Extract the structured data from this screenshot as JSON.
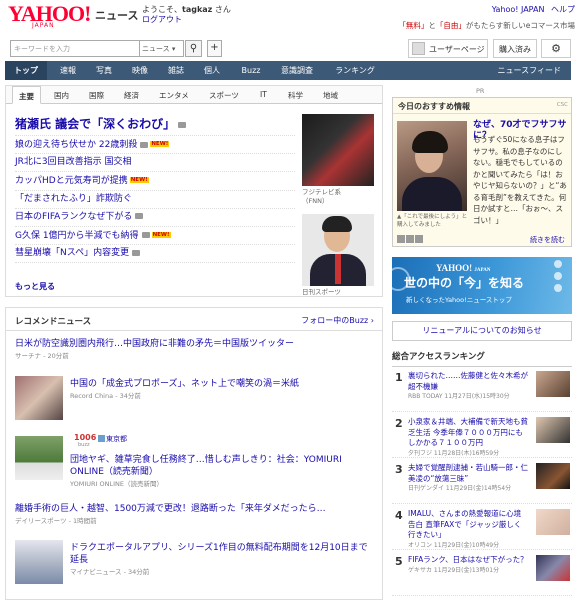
{
  "header": {
    "logo": "YAHOO!",
    "logo_sub": "JAPAN",
    "section": "ニュース",
    "welcome_prefix": "ようこそ、",
    "username": "tagkaz",
    "welcome_suffix": " さん",
    "logout": "ログアウト",
    "yahoo_japan_link": "Yahoo! JAPAN",
    "help_link": "ヘルプ",
    "promo_a": "「無料」",
    "promo_mid": "と",
    "promo_b": "「自由」",
    "promo_rest": "がもたらす新しいeコマース市場"
  },
  "search": {
    "placeholder": "キーワードを入力",
    "scope": "ニュース ▾",
    "user_page": "ユーザーページ",
    "purchased": "購入済み"
  },
  "nav": {
    "items": [
      "トップ",
      "速報",
      "写真",
      "映像",
      "雑誌",
      "個人",
      "Buzz",
      "意識調査",
      "ランキング"
    ],
    "feed": "ニュースフィード"
  },
  "subtabs": [
    "主要",
    "国内",
    "国際",
    "経済",
    "エンタメ",
    "スポーツ",
    "IT",
    "科学",
    "地域"
  ],
  "headlines": [
    {
      "text": "猪瀬氏 議会で「深くおわび」",
      "photo": true,
      "new": false
    },
    {
      "text": "娘の迎え待ち伏せか 22歳刺殺",
      "photo": true,
      "new": true
    },
    {
      "text": "JR北に3回目改善指示 国交相",
      "photo": false,
      "new": false
    },
    {
      "text": "カッパHDと元気寿司が提携",
      "photo": false,
      "new": true
    },
    {
      "text": "「だまされたふり」詐欺防ぐ",
      "photo": false,
      "new": false
    },
    {
      "text": "日本のFIFAランクなぜ下がる",
      "photo": true,
      "new": false
    },
    {
      "text": "G久保 1億円から半減でも納得",
      "photo": true,
      "new": true
    },
    {
      "text": "彗星崩壊「Nスペ」内容変更",
      "photo": true,
      "new": false
    }
  ],
  "new_badge": "NEW!",
  "more": "もっと見る",
  "thumb_captions": {
    "first_a": "フジテレビ系",
    "first_b": "（FNN）",
    "second": "日刊スポーツ"
  },
  "recommend": {
    "title": "レコメンドニュース",
    "buzz_link": "フォロー中のBuzz",
    "items": [
      {
        "text": "日米が防空識別圏内飛行…中国政府に非難の矛先＝中国版ツイッター",
        "source": "サーチナ - 20分前"
      },
      {
        "text": "中国の「成金式プロポーズ」、ネット上で嘲笑の渦＝米紙",
        "source": "Record China - 34分前"
      },
      {
        "text": "団地ヤギ、雑草完食し任務終了…惜しむ声しきり：社会：YOMIURI ONLINE（読売新聞）",
        "source": "YOMIURI ONLINE（読売新聞）"
      },
      {
        "text": "離婚手術の巨人・越智、1500万減で更改！退路断った「来年ダメだったら…",
        "source": "デイリースポーツ - 1時間前"
      },
      {
        "text": "ドラクエポータルアプリ、シリーズ1作目の無料配布期間を12月10日まで延長",
        "source": "マイナビニュース - 34分前"
      }
    ],
    "buzz_count": "1006",
    "buzz_word": "buzz",
    "buzz_org": "東京都"
  },
  "pr_label": "PR",
  "today_reco": {
    "title": "今日のおすすめ情報",
    "ad": "CSC",
    "headline": "なぜ、70才でフサフサに？",
    "body": "もうずぐ50になる息子はフサフサ。私の息子なのにしない。穏毛でもしているのかと聞いてみたら「は！おやじヤ知らないの？」と“ある育毛剤”を教えてきた。何日か試すと…「おぉ〜、スゴい！」",
    "caption": "▲「これで最後にしよう」と購入してみました",
    "more": "続きを読む"
  },
  "banner": {
    "logo": "YAHOO!",
    "logo_sub": "JAPAN",
    "main": "世の中の「今」を知る",
    "sub": "新しくなったYahoo!ニューストップ"
  },
  "renewal": "リニューアルについてのお知らせ",
  "ranking": {
    "title": "総合アクセスランキング",
    "items": [
      {
        "num": "1",
        "text": "裏切られた……佐藤健と佐々木希が超不機嫌",
        "meta": "RBB TODAY 11月27日(水)15時30分"
      },
      {
        "num": "2",
        "text": "小泉家＆井端、大補備で新天地も貧乏生活 今季年俸７０００万円にもしかかる７１００万円",
        "meta": "夕刊フジ 11月28日(木)16時59分"
      },
      {
        "num": "3",
        "text": "夫婦で覚醒剤逮捕・若山騎一郎・仁美凌の“放蕩三昧”",
        "meta": "日刊ゲンダイ 11月29日(金)14時54分"
      },
      {
        "num": "4",
        "text": "IMALU、さんまの熱愛報道に心境告白 直筆FAXで「ジャッジ厳しく行きたい」",
        "meta": "オリコン 11月29日(金)10時49分"
      },
      {
        "num": "5",
        "text": "FIFAランク、日本はなぜ下がった？",
        "meta": "ゲキサカ 11月29日(金)13時01分"
      }
    ]
  },
  "colors": {
    "nav_bg": "#3c5977",
    "logo_red": "#ff0033",
    "link": "#1a0dab"
  }
}
